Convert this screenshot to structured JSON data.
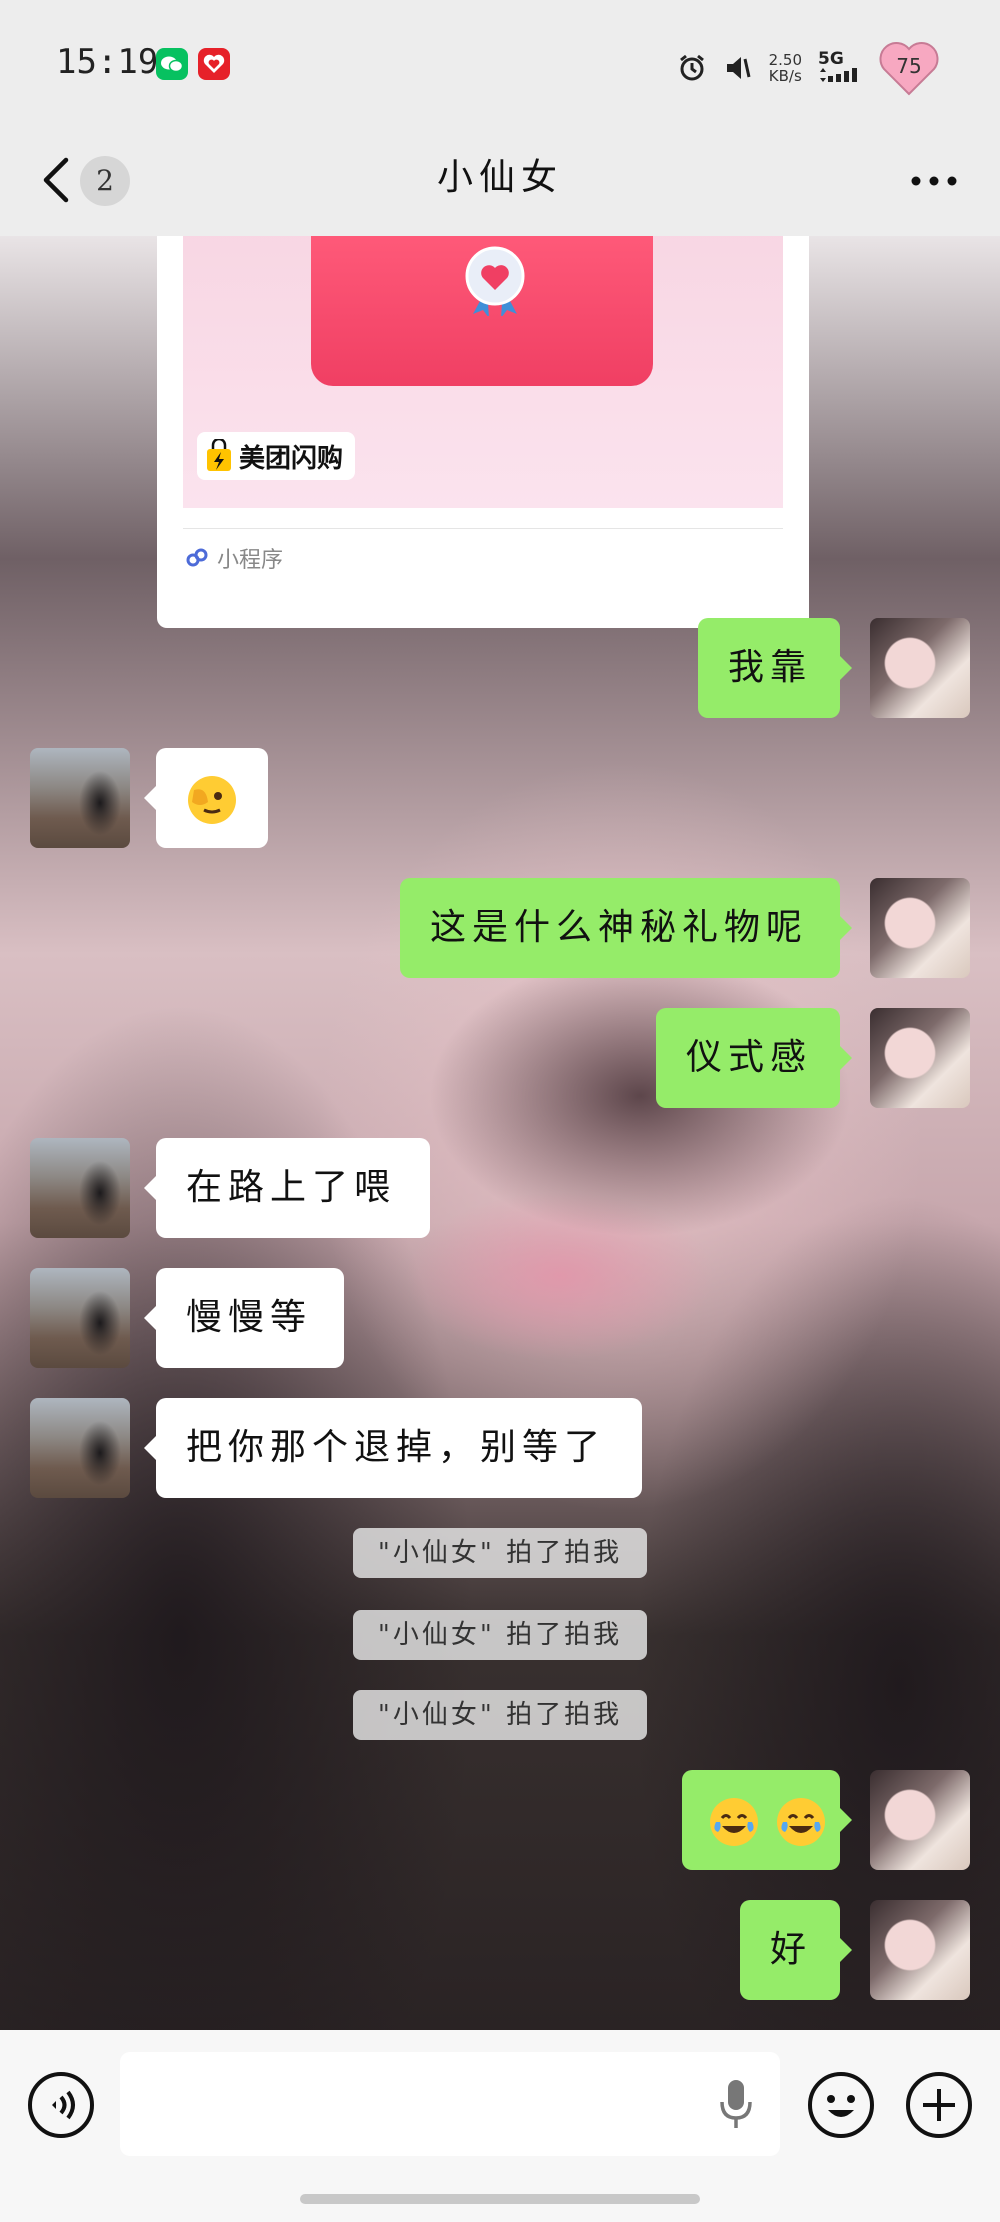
{
  "status_bar": {
    "time": "15:19",
    "net_speed_value": "2.50",
    "net_speed_unit": "KB/s",
    "network": "5G",
    "battery_badge": "75"
  },
  "nav": {
    "unread_count": "2",
    "title": "小仙女"
  },
  "card": {
    "brand": "美团闪购",
    "source": "小程序"
  },
  "messages": {
    "m1": "我靠",
    "m3": "这是什么神秘礼物呢",
    "m4": "仪式感",
    "m5": "在路上了喂",
    "m6": "慢慢等",
    "m7": "把你那个退掉，别等了",
    "sys1": "\"小仙女\" 拍了拍我",
    "sys2": "\"小仙女\" 拍了拍我",
    "sys3": "\"小仙女\" 拍了拍我",
    "m10": "好"
  },
  "colors": {
    "mine_bubble": "#95ec69",
    "theirs_bubble": "#ffffff",
    "wechat_green": "#07c160"
  },
  "icons": {
    "back": "chevron-left-icon",
    "more": "more-dots-icon",
    "voice": "voice-icon",
    "mic": "mic-icon",
    "emoji": "emoji-icon",
    "plus": "plus-icon"
  }
}
